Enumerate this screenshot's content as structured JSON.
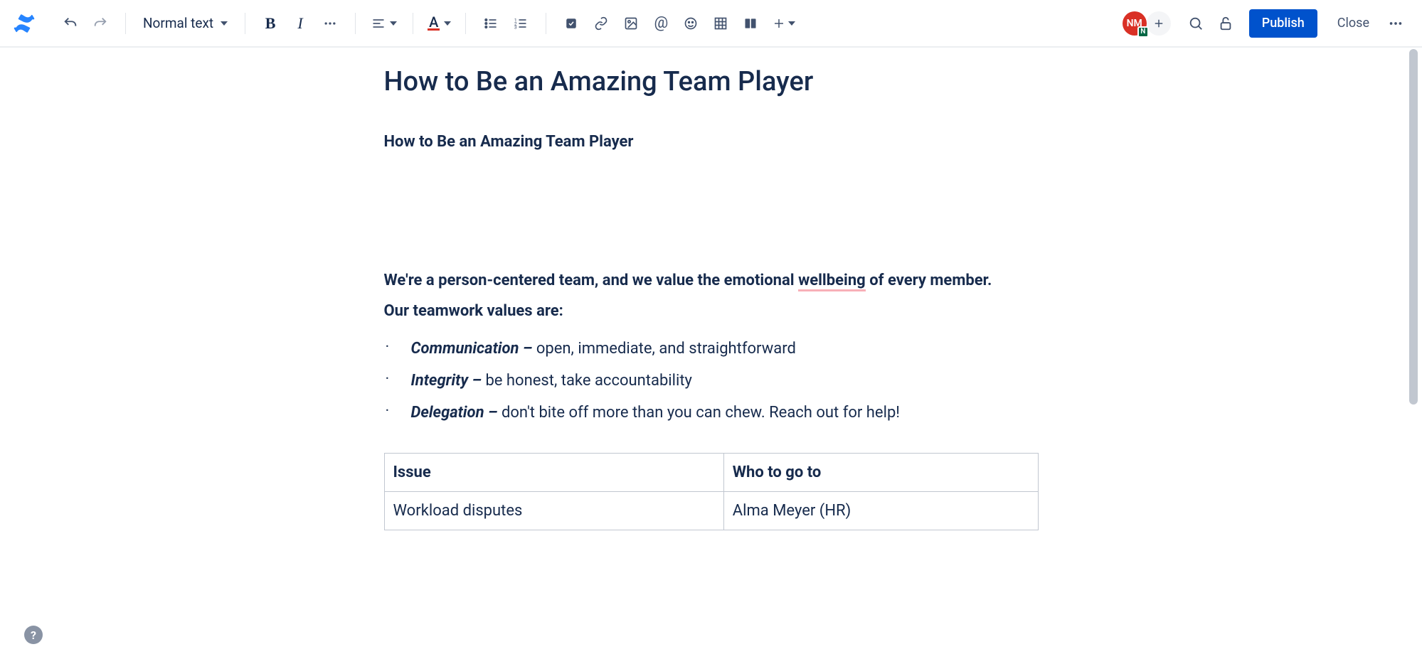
{
  "toolbar": {
    "style_selector": "Normal text",
    "publish": "Publish",
    "close": "Close"
  },
  "avatar": {
    "initials": "NM",
    "badge": "N"
  },
  "doc": {
    "title": "How to Be an Amazing Team Player",
    "subtitle": "How to Be an Amazing Team Player",
    "intro_prefix": "We're a person-centered team, and we value the emotional ",
    "intro_spell": "wellbeing",
    "intro_suffix": " of every member.",
    "values_heading": "Our teamwork values are:",
    "values": [
      {
        "term": "Communication – ",
        "desc": "open, immediate, and straightforward"
      },
      {
        "term": "Integrity – ",
        "desc": "be honest, take accountability"
      },
      {
        "term": "Delegation – ",
        "desc": "don't bite off more than you can chew. Reach out for help!"
      }
    ],
    "table": {
      "head": [
        "Issue",
        "Who to go to"
      ],
      "rows": [
        [
          "Workload disputes",
          "Alma Meyer (HR)"
        ]
      ]
    }
  },
  "colors": {
    "primary": "#0052cc",
    "text": "#172b4d"
  }
}
